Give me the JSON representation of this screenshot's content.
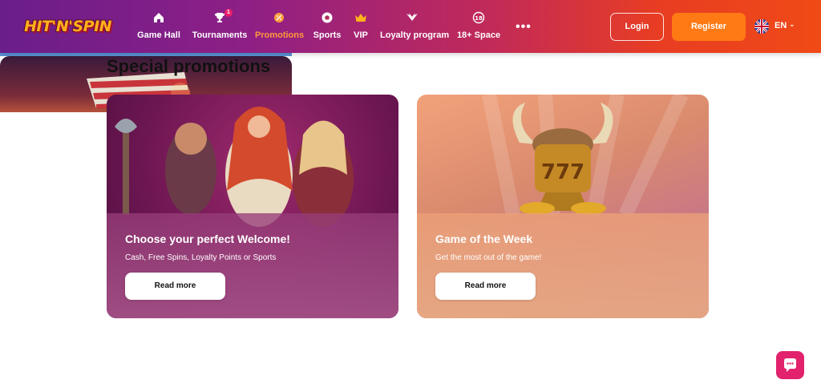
{
  "brand": {
    "logo_text": "HIT'N'SPIN"
  },
  "nav": {
    "items": [
      {
        "label": "Game Hall",
        "icon": "home-icon"
      },
      {
        "label": "Tournaments",
        "icon": "trophy-icon",
        "badge": "1"
      },
      {
        "label": "Promotions",
        "icon": "promo-icon",
        "active": true
      },
      {
        "label": "Sports",
        "icon": "ball-icon"
      },
      {
        "label": "VIP",
        "icon": "crown-icon"
      },
      {
        "label": "Loyalty program",
        "icon": "wings-icon"
      },
      {
        "label": "18+ Space",
        "icon": "age-18-icon"
      }
    ],
    "more": "•••"
  },
  "auth": {
    "login_label": "Login",
    "register_label": "Register"
  },
  "language": {
    "code": "EN",
    "flag": "uk-flag-icon"
  },
  "main": {
    "title": "Special promotions",
    "cards": [
      {
        "title": "Choose your perfect Welcome!",
        "subtitle": "Cash, Free Spins, Loyalty Points or Sports",
        "button": "Read more"
      },
      {
        "title": "Game of the Week",
        "subtitle": "Get the most out of the game!",
        "button": "Read more"
      }
    ]
  },
  "colors": {
    "accent": "#ff7a14",
    "active_nav": "#ff9a3c",
    "chat": "#e2226c"
  }
}
